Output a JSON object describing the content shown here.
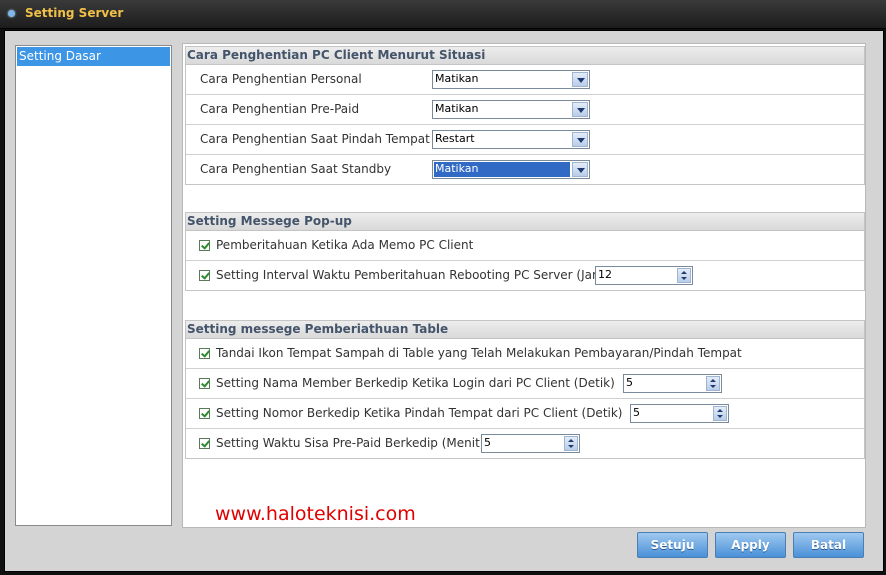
{
  "window": {
    "title": "Setting Server"
  },
  "sidebar": {
    "items": [
      {
        "label": "Setting Dasar"
      }
    ]
  },
  "sections": {
    "shutdown": {
      "title": "Cara Penghentian PC Client Menurut Situasi",
      "rows": [
        {
          "label": "Cara Penghentian Personal",
          "value": "Matikan"
        },
        {
          "label": "Cara Penghentian Pre-Paid",
          "value": "Matikan"
        },
        {
          "label": "Cara Penghentian Saat Pindah Tempat",
          "value": "Restart"
        },
        {
          "label": "Cara Penghentian Saat Standby",
          "value": "Matikan"
        }
      ]
    },
    "popup": {
      "title": "Setting Messege Pop-up",
      "rows": [
        {
          "label": "Pemberitahuan Ketika Ada Memo PC Client",
          "checked": true
        },
        {
          "label": "Setting Interval Waktu Pemberitahuan Rebooting PC Server (Jam)",
          "checked": true,
          "value": "12"
        }
      ]
    },
    "table": {
      "title": "Setting messege Pemberiathuan Table",
      "rows": [
        {
          "label": "Tandai Ikon Tempat Sampah di Table yang Telah Melakukan Pembayaran/Pindah Tempat",
          "checked": true
        },
        {
          "label": "Setting Nama Member Berkedip Ketika Login dari PC Client (Detik)",
          "checked": true,
          "value": "5"
        },
        {
          "label": "Setting Nomor Berkedip Ketika Pindah Tempat dari PC Client (Detik)",
          "checked": true,
          "value": "5"
        },
        {
          "label": "Setting Waktu Sisa Pre-Paid Berkedip (Menit)",
          "checked": true,
          "value": "5"
        }
      ]
    }
  },
  "watermark": "www.haloteknisi.com",
  "buttons": {
    "ok": "Setuju",
    "apply": "Apply",
    "cancel": "Batal"
  },
  "colors": {
    "title": "#f0c048",
    "accent": "#3d95e6",
    "watermark": "#e00000"
  }
}
